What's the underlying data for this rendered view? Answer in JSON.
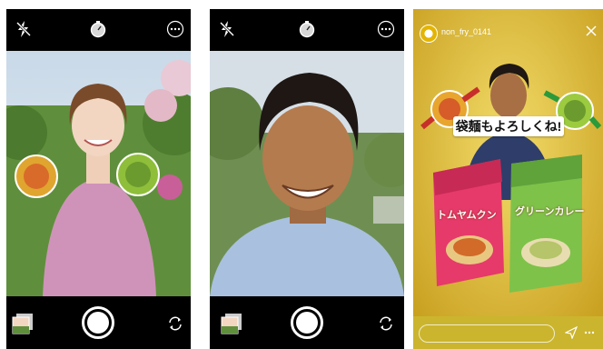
{
  "panels": [
    {
      "id": "camera-1",
      "icons": [
        "flash-off-icon",
        "timer-icon",
        "more-icon",
        "gallery-icon",
        "shutter-icon",
        "flip-camera-icon"
      ]
    },
    {
      "id": "camera-2",
      "icons": [
        "flash-off-icon",
        "timer-icon",
        "more-icon",
        "gallery-icon",
        "shutter-icon",
        "flip-camera-icon"
      ]
    },
    {
      "id": "story-3",
      "icons": [
        "avatar-icon",
        "close-icon",
        "send-icon",
        "more-horizontal-icon"
      ]
    }
  ],
  "story": {
    "username": "non_fry_0141",
    "caption": "袋麺もよろしくね!",
    "products": [
      "トムヤムクン",
      "グリーンカレー"
    ],
    "message_placeholder": ""
  },
  "colors": {
    "accent": "#d9b32a",
    "bar": "#000000"
  }
}
